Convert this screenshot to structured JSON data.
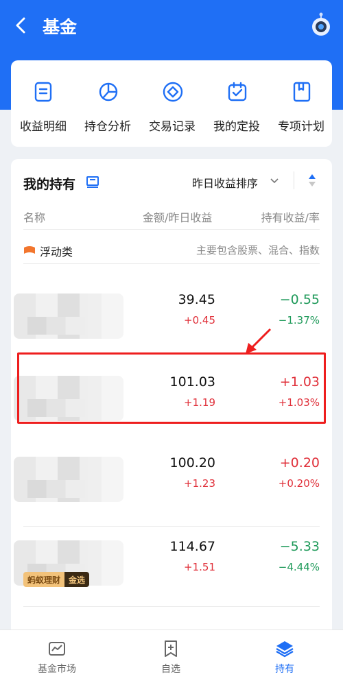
{
  "header": {
    "title": "基金"
  },
  "quick_actions": [
    {
      "label": "收益明细",
      "icon": "document-list-icon"
    },
    {
      "label": "持仓分析",
      "icon": "pie-chart-icon"
    },
    {
      "label": "交易记录",
      "icon": "exchange-record-icon"
    },
    {
      "label": "我的定投",
      "icon": "calendar-check-icon"
    },
    {
      "label": "专项计划",
      "icon": "bookmark-icon"
    }
  ],
  "holdings": {
    "title": "我的持有",
    "sort_label": "昨日收益排序",
    "columns": {
      "name": "名称",
      "amount": "金额/昨日收益",
      "return": "持有收益/率"
    },
    "category": {
      "name": "浮动类",
      "desc": "主要包含股票、混合、指数"
    },
    "funds": [
      {
        "amount": "39.45",
        "yesterday": "+0.45",
        "hold_return": "−0.55",
        "hold_rate": "−1.37%",
        "trend": "down"
      },
      {
        "amount": "101.03",
        "yesterday": "+1.19",
        "hold_return": "+1.03",
        "hold_rate": "+1.03%",
        "trend": "up"
      },
      {
        "amount": "100.20",
        "yesterday": "+1.23",
        "hold_return": "+0.20",
        "hold_rate": "+0.20%",
        "trend": "up"
      },
      {
        "amount": "114.67",
        "yesterday": "+1.51",
        "hold_return": "−5.33",
        "hold_rate": "−4.44%",
        "trend": "down"
      }
    ],
    "badge": {
      "left": "蚂蚁理财",
      "right": "金选"
    }
  },
  "colors": {
    "brand": "#1f6ff5",
    "up": "#e0303a",
    "down": "#1f9a5a"
  },
  "tabbar": [
    {
      "label": "基金市场",
      "icon": "market-icon"
    },
    {
      "label": "自选",
      "icon": "add-favorite-icon"
    },
    {
      "label": "持有",
      "icon": "layers-icon",
      "active": true
    }
  ]
}
